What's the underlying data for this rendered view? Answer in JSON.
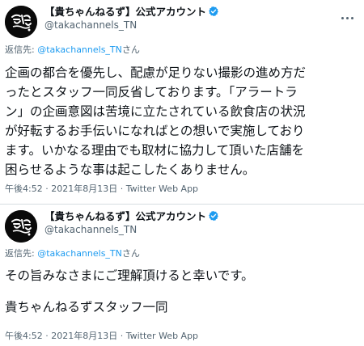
{
  "colors": {
    "accent": "#1d9bf0",
    "muted": "#536471",
    "text": "#0f1419",
    "border": "#d6dde2"
  },
  "tweets": [
    {
      "display_name": "【貴ちゃんねるず】公式アカウント",
      "handle": "@takachannels_TN",
      "reply_prefix": "返信先: ",
      "reply_mention": "@takachannels_TN",
      "reply_suffix": "さん",
      "body_lines": [
        "企画の都合を優先し、配慮が足りない撮影の進め方だ",
        "ったとスタッフ一同反省しております。「アラートラ",
        "ン」の企画意図は苦境に立たされている飲食店の状況",
        "が好転するお手伝いになればとの想いで実施しており",
        "ます。いかなる理由でも取材に協力して頂いた店舗を",
        "困らせるような事は起こしたくありません。"
      ],
      "time": "午後4:52",
      "date": "2021年8月13日",
      "source": "Twitter Web App",
      "verified_icon": "verified-badge-icon",
      "avatar_icon": "channel-logo-avatar"
    },
    {
      "display_name": "【貴ちゃんねるず】公式アカウント",
      "handle": "@takachannels_TN",
      "reply_prefix": "返信先: ",
      "reply_mention": "@takachannels_TN",
      "reply_suffix": "さん",
      "body_lines": [
        "その旨みなさまにご理解頂けると幸いです。",
        "",
        "貴ちゃんねるずスタッフ一同"
      ],
      "time": "午後4:52",
      "date": "2021年8月13日",
      "source": "Twitter Web App",
      "verified_icon": "verified-badge-icon",
      "avatar_icon": "channel-logo-avatar"
    }
  ]
}
